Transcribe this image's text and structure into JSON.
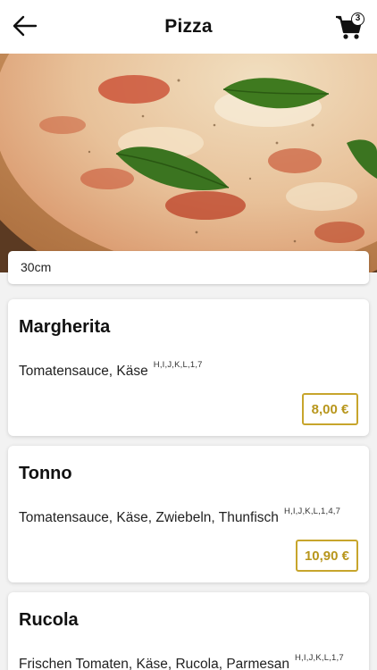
{
  "header": {
    "title": "Pizza",
    "cart_count": "3"
  },
  "size_select": {
    "value": "30cm"
  },
  "products": [
    {
      "name": "Margherita",
      "ingredients": "Tomatensauce, Käse",
      "allergens": "H,I,J,K,L,1,7",
      "price": "8,00 €"
    },
    {
      "name": "Tonno",
      "ingredients": "Tomatensauce, Käse, Zwiebeln, Thunfisch",
      "allergens": "H,I,J,K,L,1,4,7",
      "price": "10,90 €"
    },
    {
      "name": "Rucola",
      "ingredients": "Frischen Tomaten, Käse, Rucola, Parmesan",
      "allergens": "H,I,J,K,L,1,7",
      "price": ""
    }
  ],
  "colors": {
    "accent": "#c7a52c",
    "price_text": "#b8961c",
    "background": "#f2f2f2"
  },
  "icons": {
    "back": "arrow-left-icon",
    "cart": "shopping-cart-icon"
  }
}
